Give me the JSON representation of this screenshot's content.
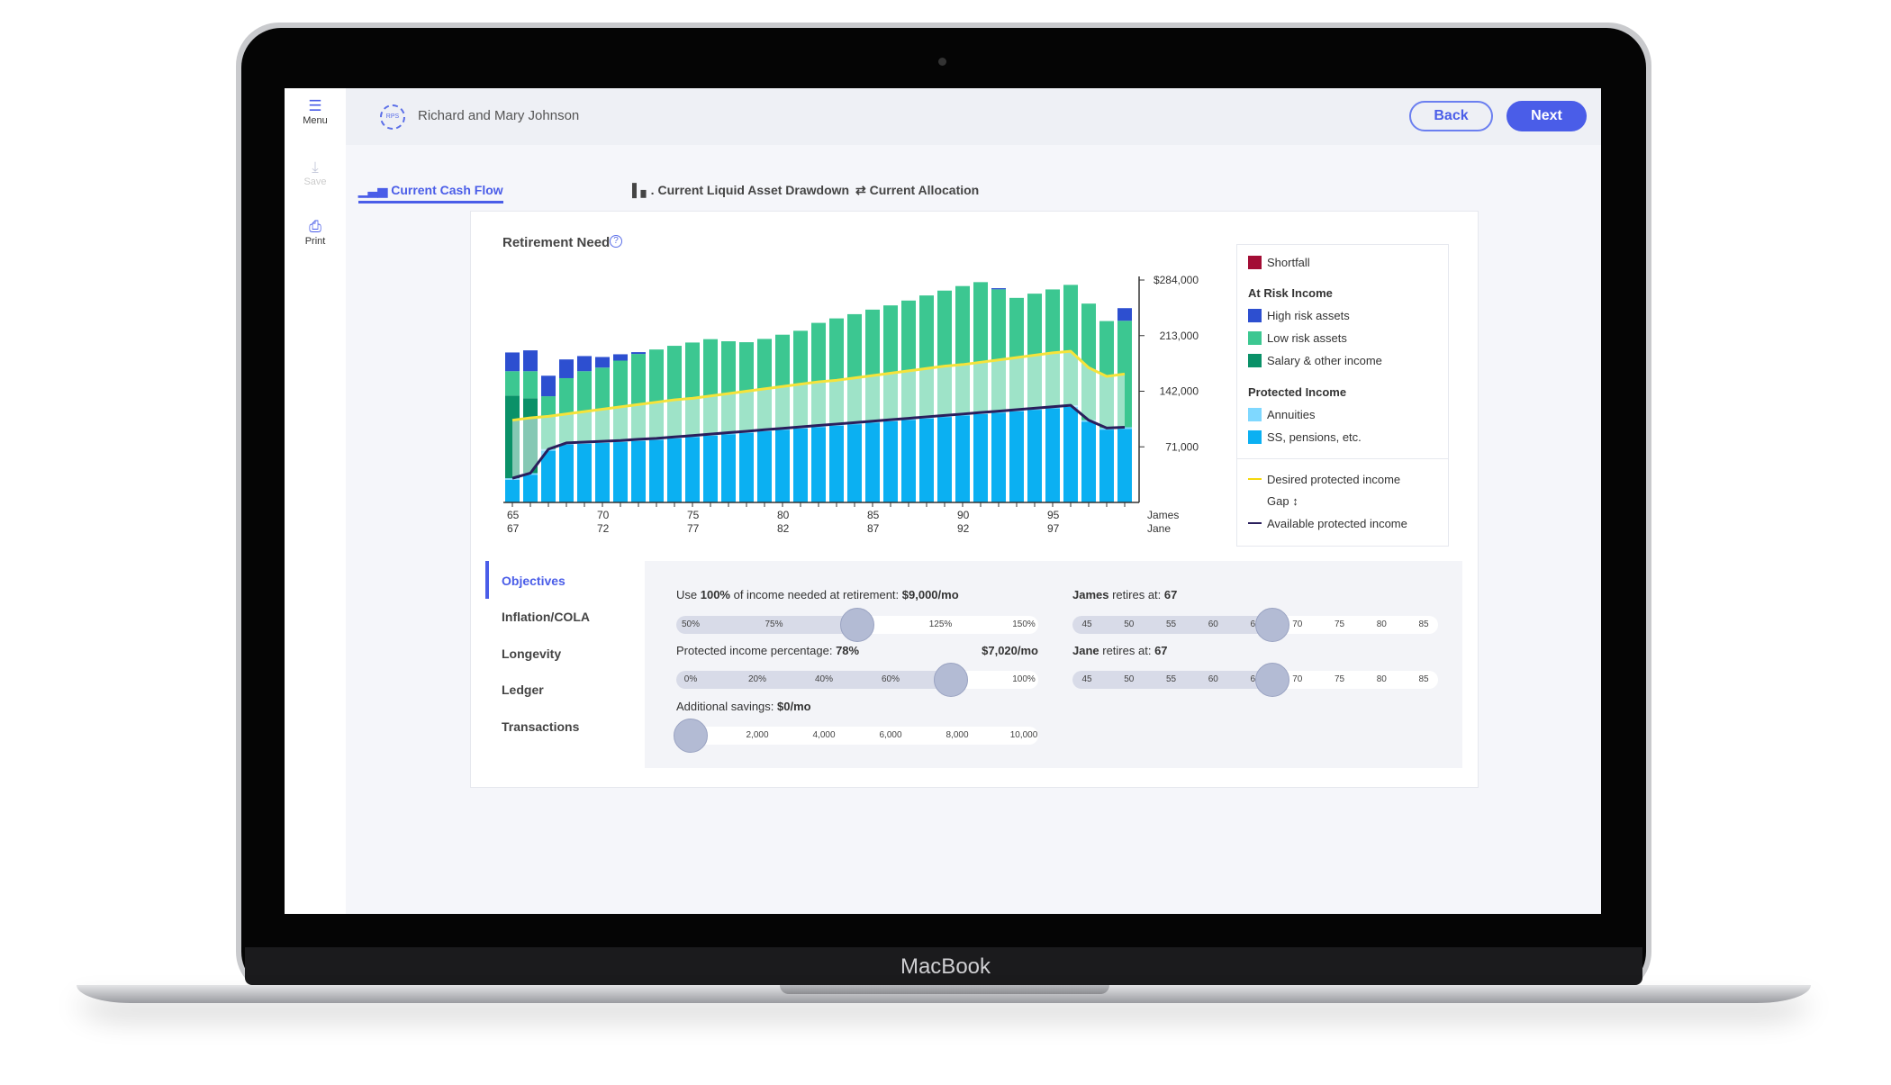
{
  "device": {
    "brand": "MacBook"
  },
  "sidebar": {
    "items": [
      {
        "label": "Menu",
        "icon": "menu-icon"
      },
      {
        "label": "Save",
        "icon": "download-icon"
      },
      {
        "label": "Print",
        "icon": "printer-icon"
      }
    ]
  },
  "header": {
    "logo": "RPS",
    "client": "Richard and Mary Johnson",
    "back": "Back",
    "next": "Next"
  },
  "tabs": [
    {
      "label": "Current Cash Flow",
      "icon": "bar-chart-icon",
      "active": true
    },
    {
      "label": "Current Liquid Asset Drawdown",
      "icon": "drawdown-chart-icon"
    },
    {
      "label": "Current Allocation",
      "icon": "swap-arrows-icon"
    }
  ],
  "colors": {
    "accent": "#4a5de8",
    "shortfall": "#a30d35",
    "high_risk": "#2d4fd0",
    "low_risk": "#3cc791",
    "salary": "#0a9168",
    "annuities": "#7fd8ff",
    "ss": "#0bb0f2",
    "desired": "#f5e33b",
    "available": "#2a1f5c"
  },
  "chart_data": {
    "type": "bar",
    "title": "Retirement Need",
    "stacked": true,
    "x_labels_james": [
      "65",
      "70",
      "75",
      "80",
      "85",
      "90",
      "95"
    ],
    "x_labels_jane": [
      "67",
      "72",
      "77",
      "82",
      "87",
      "92",
      "97"
    ],
    "x_row_labels": [
      "James",
      "Jane"
    ],
    "james_age": [
      65,
      66,
      67,
      68,
      69,
      70,
      71,
      72,
      73,
      74,
      75,
      76,
      77,
      78,
      79,
      80,
      81,
      82,
      83,
      84,
      85,
      86,
      87,
      88,
      89,
      90,
      91,
      92,
      93,
      94,
      95,
      96,
      97,
      98,
      99
    ],
    "yticks": [
      {
        "value": 284000,
        "label": "$284,000"
      },
      {
        "value": 213000,
        "label": "213,000"
      },
      {
        "value": 142000,
        "label": "142,000"
      },
      {
        "value": 71000,
        "label": "71,000"
      }
    ],
    "ylim": [
      0,
      284000
    ],
    "series": [
      {
        "name": "SS, pensions, etc.",
        "color": "#0bb0f2",
        "values": [
          28900,
          35400,
          66000,
          74000,
          75000,
          76000,
          77000,
          78600,
          79800,
          81600,
          83400,
          85300,
          87100,
          88900,
          90800,
          92600,
          94400,
          96300,
          98100,
          99900,
          101800,
          103600,
          105400,
          107300,
          109100,
          110900,
          112800,
          114600,
          116400,
          118300,
          120100,
          122000,
          103000,
          93000,
          94000
        ]
      },
      {
        "name": "Annuities",
        "color": "#7fd8ff",
        "values": [
          2000,
          2000,
          2000,
          2000,
          2000,
          2000,
          2000,
          2000,
          2000,
          2000,
          2000,
          2000,
          2000,
          2000,
          2000,
          2000,
          2000,
          2000,
          2000,
          2000,
          2000,
          2000,
          2000,
          2000,
          2000,
          2000,
          2000,
          2000,
          2000,
          2000,
          2000,
          2000,
          2000,
          2000,
          2000
        ]
      },
      {
        "name": "Salary & other income",
        "color": "#0a9168",
        "values": [
          105500,
          95600,
          0,
          0,
          0,
          0,
          0,
          0,
          0,
          0,
          0,
          0,
          0,
          0,
          0,
          0,
          0,
          0,
          0,
          0,
          0,
          0,
          0,
          0,
          0,
          0,
          0,
          0,
          0,
          0,
          0,
          0,
          0,
          0,
          0
        ]
      },
      {
        "name": "Low risk assets",
        "color": "#3cc791",
        "values": [
          31200,
          34600,
          67600,
          82700,
          90600,
          94200,
          102100,
          109000,
          113500,
          116400,
          118800,
          121200,
          116700,
          113700,
          116000,
          119600,
          122800,
          131000,
          134900,
          138500,
          142400,
          146000,
          150400,
          155000,
          159400,
          163400,
          166500,
          155500,
          142800,
          146300,
          149900,
          153800,
          148900,
          136600,
          136000
        ]
      },
      {
        "name": "High risk assets",
        "color": "#2d4fd0",
        "values": [
          23900,
          26600,
          26200,
          23900,
          19300,
          13500,
          8100,
          2300,
          0,
          0,
          0,
          0,
          0,
          0,
          0,
          0,
          0,
          0,
          0,
          0,
          0,
          0,
          0,
          0,
          0,
          0,
          0,
          1500,
          0,
          0,
          0,
          0,
          0,
          0,
          16100
        ]
      },
      {
        "name": "Shortfall",
        "color": "#a30d35",
        "values": [
          0,
          0,
          0,
          0,
          0,
          0,
          0,
          0,
          0,
          0,
          0,
          0,
          0,
          0,
          0,
          0,
          0,
          0,
          0,
          0,
          0,
          0,
          0,
          0,
          0,
          0,
          0,
          0,
          0,
          0,
          0,
          0,
          0,
          0,
          0
        ]
      }
    ],
    "lines": [
      {
        "name": "Desired protected income",
        "color": "#f5e33b",
        "values": [
          105000,
          108000,
          110000,
          113000,
          116000,
          119000,
          122000,
          125000,
          128000,
          131000,
          133000,
          136000,
          139000,
          142000,
          145000,
          148000,
          151000,
          154000,
          156000,
          159000,
          162000,
          165000,
          168000,
          171000,
          174000,
          176000,
          179000,
          182000,
          185000,
          188000,
          191000,
          193000,
          172000,
          161000,
          164000
        ]
      },
      {
        "name": "Available protected income",
        "color": "#2a1f5c",
        "values": [
          30900,
          37400,
          68000,
          76000,
          77000,
          78000,
          79000,
          80600,
          81800,
          83600,
          85400,
          87300,
          89100,
          90900,
          92800,
          94600,
          96400,
          98300,
          100100,
          101900,
          103800,
          105600,
          107400,
          109300,
          111100,
          112900,
          114800,
          116600,
          118400,
          120300,
          122100,
          124000,
          105000,
          95000,
          96000
        ]
      }
    ],
    "grid": false,
    "legend_placement": "right"
  },
  "legend": {
    "shortfall": "Shortfall",
    "at_risk": "At Risk Income",
    "high": "High risk assets",
    "low": "Low risk assets",
    "salary": "Salary & other income",
    "protected": "Protected Income",
    "annuities": "Annuities",
    "ss": "SS, pensions, etc.",
    "desired": "Desired protected income",
    "gap": "Gap",
    "gap_icon": "↕",
    "available": "Available protected income"
  },
  "objectives_nav": [
    {
      "label": "Objectives",
      "active": true
    },
    {
      "label": "Inflation/COLA"
    },
    {
      "label": "Longevity"
    },
    {
      "label": "Ledger"
    },
    {
      "label": "Transactions"
    }
  ],
  "sliders": {
    "income": {
      "pre": "Use ",
      "pct": "100%",
      "mid": " of income needed at retirement: ",
      "amount": "$9,000/mo",
      "value": 100,
      "min": 50,
      "max": 150,
      "ticks": [
        [
          "50%",
          50
        ],
        [
          "75%",
          75
        ],
        [
          "125%",
          125
        ],
        [
          "150%",
          150
        ]
      ]
    },
    "protected": {
      "pre": "Protected income percentage: ",
      "pct": "78%",
      "amount": "$7,020/mo",
      "value": 78,
      "min": 0,
      "max": 100,
      "ticks": [
        [
          "0%",
          0
        ],
        [
          "20%",
          20
        ],
        [
          "40%",
          40
        ],
        [
          "60%",
          60
        ],
        [
          "100%",
          100
        ]
      ]
    },
    "savings": {
      "pre": "Additional savings: ",
      "amount": "$0/mo",
      "value": 0,
      "min": 0,
      "max": 10000,
      "ticks": [
        [
          "2,000",
          2000
        ],
        [
          "4,000",
          4000
        ],
        [
          "6,000",
          6000
        ],
        [
          "8,000",
          8000
        ],
        [
          "10,000",
          10000
        ]
      ]
    },
    "james": {
      "name": "James",
      "mid": " retires at: ",
      "age": "67",
      "value": 67,
      "min": 45,
      "max": 85,
      "ticks": [
        [
          "45",
          45
        ],
        [
          "50",
          50
        ],
        [
          "55",
          55
        ],
        [
          "60",
          60
        ],
        [
          "65",
          65
        ],
        [
          "70",
          70
        ],
        [
          "75",
          75
        ],
        [
          "80",
          80
        ],
        [
          "85",
          85
        ]
      ]
    },
    "jane": {
      "name": "Jane",
      "mid": " retires at: ",
      "age": "67",
      "value": 67,
      "min": 45,
      "max": 85,
      "ticks": [
        [
          "45",
          45
        ],
        [
          "50",
          50
        ],
        [
          "55",
          55
        ],
        [
          "60",
          60
        ],
        [
          "65",
          65
        ],
        [
          "70",
          70
        ],
        [
          "75",
          75
        ],
        [
          "80",
          80
        ],
        [
          "85",
          85
        ]
      ]
    }
  }
}
